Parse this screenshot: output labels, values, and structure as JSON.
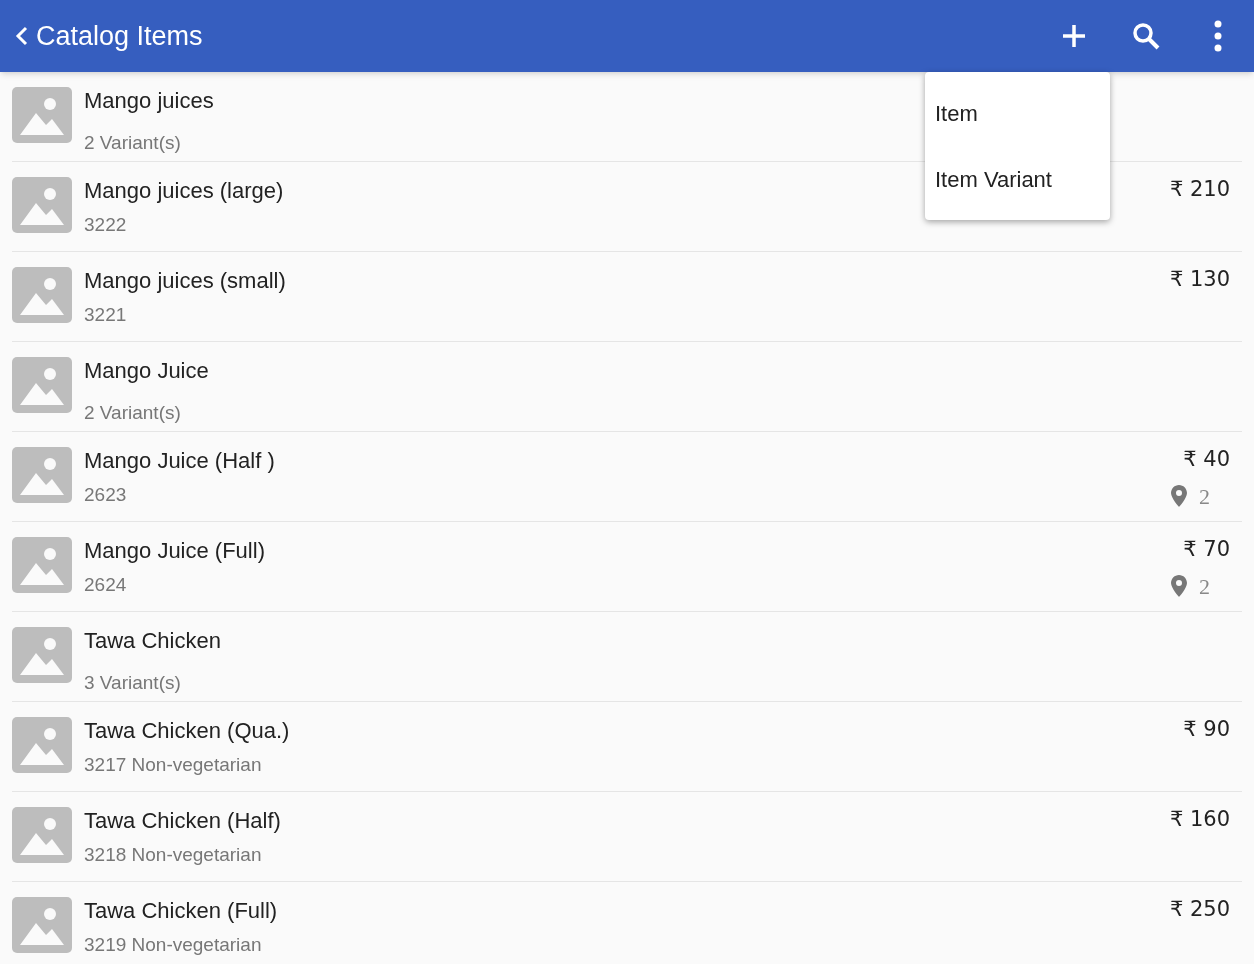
{
  "app_bar": {
    "title": "Catalog Items"
  },
  "menu": {
    "items": [
      "Item",
      "Item Variant"
    ]
  },
  "items": [
    {
      "name": "Mango juices",
      "subtitle": "2 Variant(s)",
      "kind": "group"
    },
    {
      "name": "Mango juices (large)",
      "subtitle": "3222",
      "price": "₹ 210",
      "kind": "variant"
    },
    {
      "name": "Mango juices (small)",
      "subtitle": "3221",
      "price": "₹ 130",
      "kind": "variant"
    },
    {
      "name": "Mango Juice",
      "subtitle": "2 Variant(s)",
      "kind": "group"
    },
    {
      "name": "Mango Juice (Half )",
      "subtitle": "2623",
      "price": "₹ 40",
      "locations": "2",
      "kind": "variant"
    },
    {
      "name": "Mango Juice (Full)",
      "subtitle": "2624",
      "price": "₹ 70",
      "locations": "2",
      "kind": "variant"
    },
    {
      "name": "Tawa Chicken",
      "subtitle": "3 Variant(s)",
      "kind": "group"
    },
    {
      "name": "Tawa Chicken (Qua.)",
      "subtitle": "3217 Non-vegetarian",
      "price": "₹ 90",
      "kind": "variant"
    },
    {
      "name": "Tawa Chicken (Half)",
      "subtitle": "3218 Non-vegetarian",
      "price": "₹ 160",
      "kind": "variant"
    },
    {
      "name": "Tawa Chicken (Full)",
      "subtitle": "3219 Non-vegetarian",
      "price": "₹ 250",
      "kind": "variant"
    }
  ]
}
